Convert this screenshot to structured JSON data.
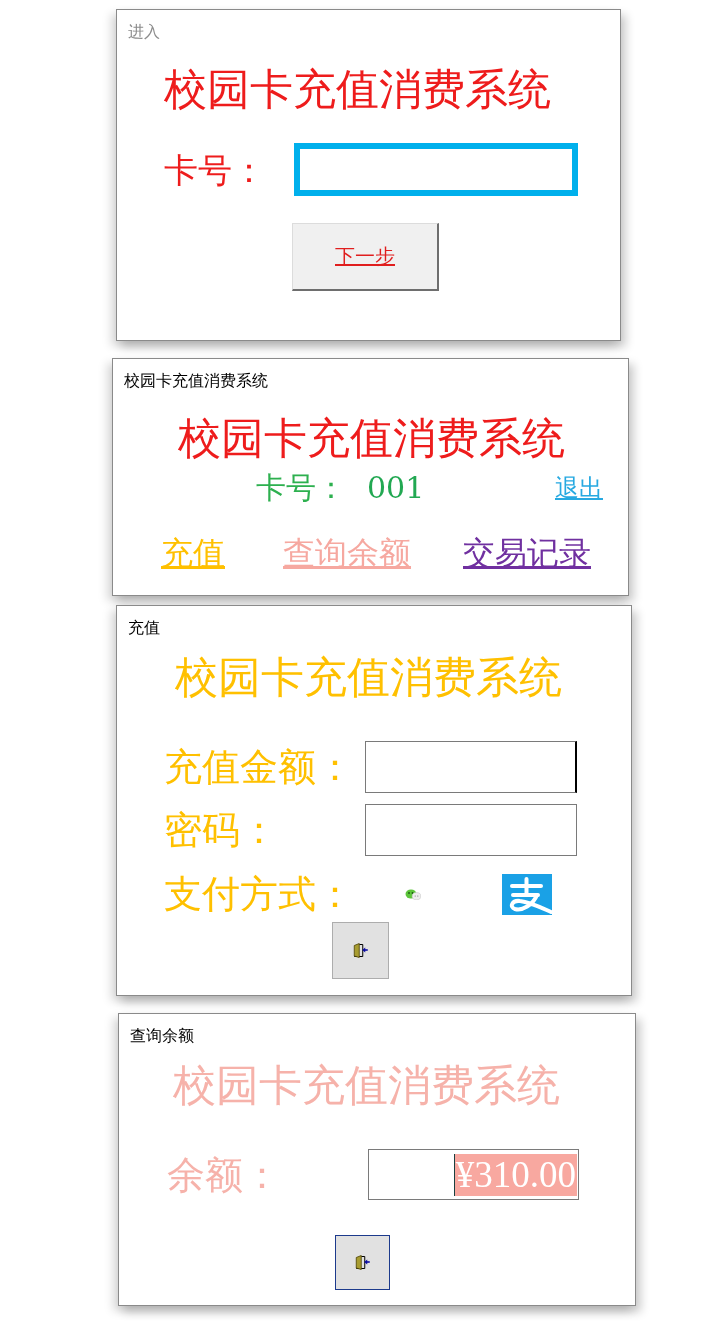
{
  "login_window": {
    "title": "进入",
    "active": false,
    "heading": "校园卡充值消费系统",
    "card_label": "卡号：",
    "card_field": {
      "focused": true
    },
    "next_button": "下一步"
  },
  "main_window": {
    "title": "校园卡充值消费系统",
    "active": true,
    "heading": "校园卡充值消费系统",
    "card_label": "卡号：",
    "card_number": "001",
    "exit_link": "退出",
    "menu": [
      {
        "label": "充值",
        "color": "#ffc000"
      },
      {
        "label": "查询余额",
        "color": "#f6a8a0"
      },
      {
        "label": "交易记录",
        "color": "#7030a0"
      }
    ]
  },
  "recharge_window": {
    "title": "充值",
    "active": true,
    "heading": "校园卡充值消费系统",
    "amount": {
      "label": "充值金额：",
      "focused": true
    },
    "password": {
      "label": "密码：",
      "focused": false
    },
    "payment_label": "支付方式：",
    "exit_button": {
      "focused": false
    }
  },
  "balance_window": {
    "title": "查询余额",
    "active": true,
    "heading": "校园卡充值消费系统",
    "balance": {
      "label": "余额：",
      "value": "¥310.00",
      "selected": true
    },
    "exit_button": {
      "focused": true
    }
  }
}
